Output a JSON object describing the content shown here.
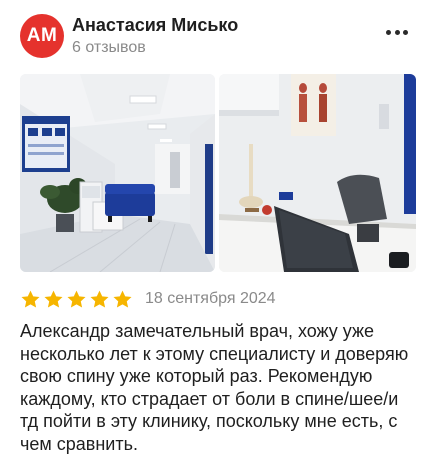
{
  "author": {
    "initials": "АМ",
    "name": "Анастасия Мисько",
    "reviews_count": "6 отзывов",
    "avatar_color": "#e5322d"
  },
  "menu_icon": "more-dots-icon",
  "photos": [
    {
      "id": "photo-corridor",
      "alt": "Коридор клиники"
    },
    {
      "id": "photo-office",
      "alt": "Кабинет врача"
    }
  ],
  "rating": {
    "value": 5,
    "max": 5,
    "star_color": "#f6b500"
  },
  "date": "18 сентября 2024",
  "review_text": "Александр замечательный врач, хожу уже несколько лет к этому специалисту и доверяю свою спину уже который раз. Рекомендую каждому, кто страдает от боли в спине/шее/и тд пойти в эту клинику, поскольку мне есть, с чем сравнить."
}
